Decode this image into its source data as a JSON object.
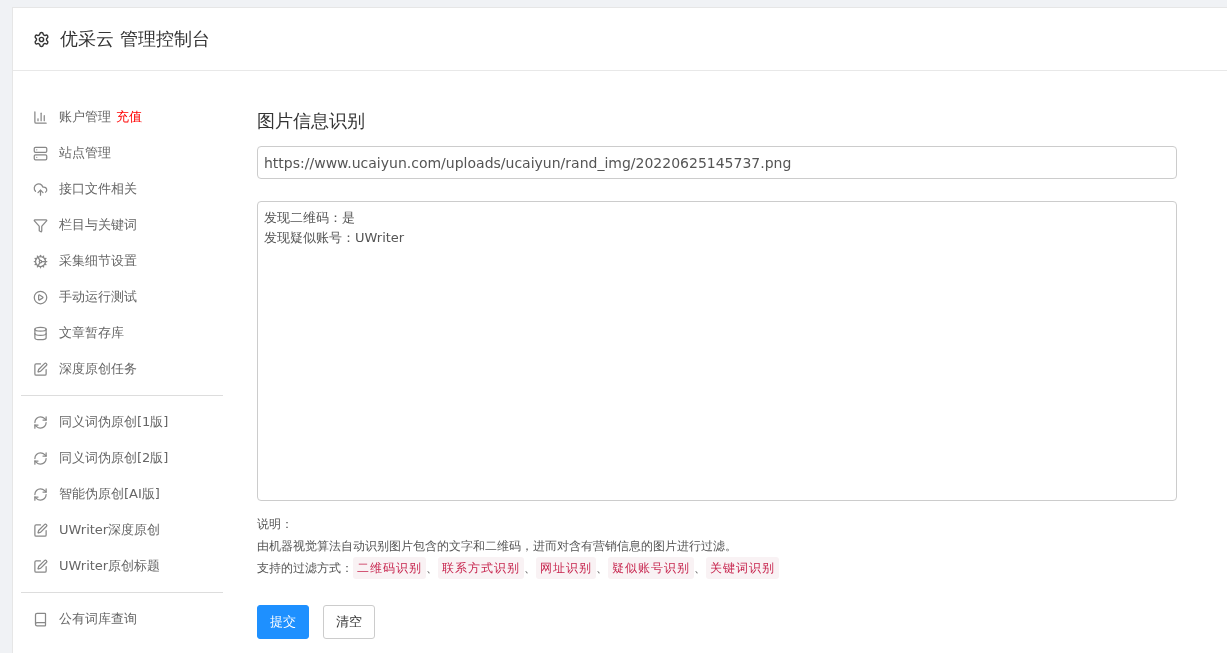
{
  "header": {
    "title": "优采云 管理控制台"
  },
  "sidebar": {
    "groups": [
      {
        "items": [
          {
            "label": "账户管理",
            "badge": "充值"
          },
          {
            "label": "站点管理"
          },
          {
            "label": "接口文件相关"
          },
          {
            "label": "栏目与关键词"
          },
          {
            "label": "采集细节设置"
          },
          {
            "label": "手动运行测试"
          },
          {
            "label": "文章暂存库"
          },
          {
            "label": "深度原创任务"
          }
        ]
      },
      {
        "items": [
          {
            "label": "同义词伪原创[1版]"
          },
          {
            "label": "同义词伪原创[2版]"
          },
          {
            "label": "智能伪原创[AI版]"
          },
          {
            "label": "UWriter深度原创"
          },
          {
            "label": "UWriter原创标题"
          }
        ]
      },
      {
        "items": [
          {
            "label": "公有词库查询"
          }
        ]
      }
    ]
  },
  "main": {
    "title": "图片信息识别",
    "url_field": {
      "value": "https://www.ucaiyun.com/uploads/ucaiyun/rand_img/20220625145737.png"
    },
    "result": {
      "lines": [
        "发现二维码：是",
        "发现疑似账号：UWriter"
      ]
    },
    "note": {
      "heading": "说明：",
      "text": "由机器视觉算法自动识别图片包含的文字和二维码，进而对含有营销信息的图片进行过滤。",
      "methods_label": "支持的过滤方式：",
      "separator": "、",
      "methods": [
        "二维码识别",
        "联系方式识别",
        "网址识别",
        "疑似账号识别",
        "关键词识别"
      ]
    },
    "buttons": [
      {
        "label": "提交",
        "kind": "primary"
      },
      {
        "label": "清空",
        "kind": "default"
      }
    ]
  }
}
